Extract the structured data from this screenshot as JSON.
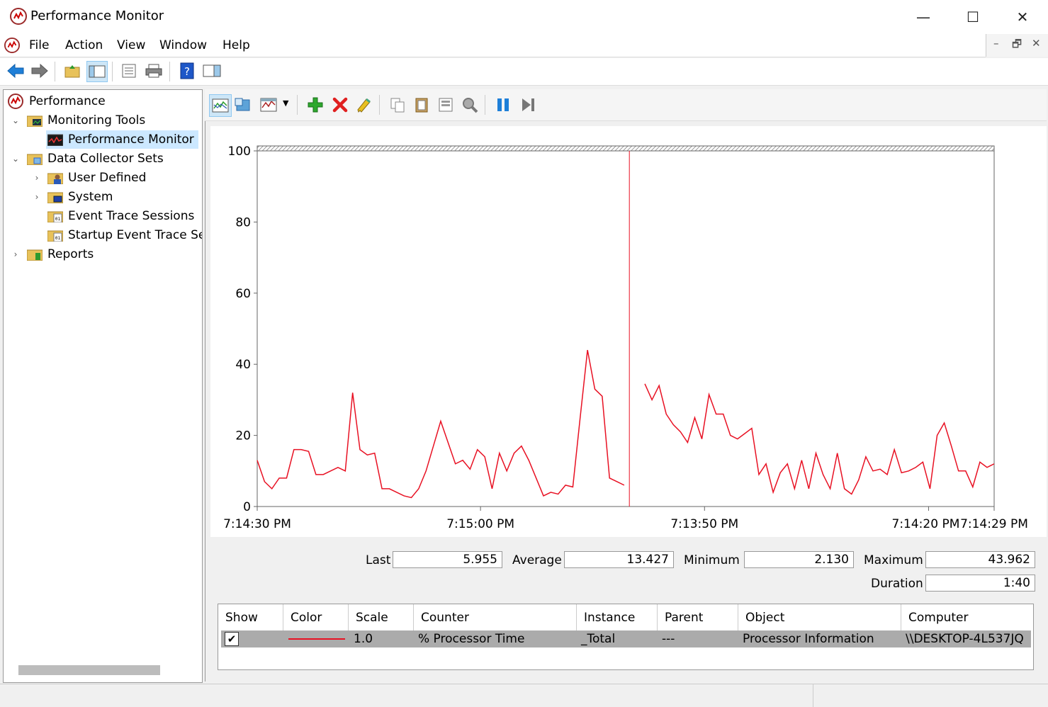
{
  "window": {
    "title": "Performance Monitor",
    "minimize": "—",
    "maximize": "☐",
    "close": "✕"
  },
  "menu": {
    "items": [
      "File",
      "Action",
      "View",
      "Window",
      "Help"
    ]
  },
  "mdi": {
    "minimize": "–",
    "restore": "🗗",
    "close": "✕"
  },
  "tree": {
    "root": "Performance",
    "monitoring_tools": "Monitoring Tools",
    "performance_monitor": "Performance Monitor",
    "data_collector_sets": "Data Collector Sets",
    "user_defined": "User Defined",
    "system": "System",
    "event_trace_sessions": "Event Trace Sessions",
    "startup_event_trace": "Startup Event Trace Sess",
    "reports": "Reports"
  },
  "chart_data": {
    "type": "line",
    "ylim": [
      0,
      100
    ],
    "yticks": [
      0,
      20,
      40,
      60,
      80,
      100
    ],
    "xticks": [
      "7:14:30 PM",
      "7:15:00 PM",
      "7:13:50 PM",
      "7:14:20 PM",
      "7:14:29 PM"
    ],
    "series": [
      {
        "color": "#e81123",
        "values": [
          13,
          7,
          5,
          8,
          8,
          16,
          16,
          15.5,
          9,
          9,
          10,
          11,
          10,
          32,
          16,
          14.5,
          15,
          5,
          5,
          4,
          3,
          2.5,
          5,
          10,
          17,
          24,
          18,
          12,
          13,
          10.5,
          16,
          14,
          5,
          15,
          10,
          15,
          17,
          13,
          8,
          3,
          4,
          3.5,
          6,
          5.5,
          25,
          44,
          33,
          31,
          8,
          7,
          6
        ]
      },
      {
        "color": "#e81123",
        "values": [
          34.5,
          30,
          34,
          26,
          23,
          21,
          18,
          25,
          19,
          31.5,
          26,
          26,
          20,
          19,
          20.5,
          22,
          9,
          12,
          4,
          9.5,
          12,
          5,
          13,
          5,
          15,
          9,
          5,
          15,
          5,
          3.5,
          7.5,
          14,
          10,
          10.5,
          9,
          16,
          9.5,
          10,
          11,
          12.5,
          5,
          20,
          23.5,
          17,
          10,
          10,
          5.5,
          12.5,
          11,
          12
        ]
      }
    ],
    "cursor_fraction": 0.505
  },
  "stats": {
    "last_label": "Last",
    "last": "5.955",
    "avg_label": "Average",
    "avg": "13.427",
    "min_label": "Minimum",
    "min": "2.130",
    "max_label": "Maximum",
    "max": "43.962",
    "dur_label": "Duration",
    "dur": "1:40"
  },
  "legend": {
    "headers": [
      "Show",
      "Color",
      "Scale",
      "Counter",
      "Instance",
      "Parent",
      "Object",
      "Computer"
    ],
    "row": {
      "show": "✔",
      "color": "#e81123",
      "scale": "1.0",
      "counter": "% Processor Time",
      "instance": "_Total",
      "parent": "---",
      "object": "Processor Information",
      "computer": "\\\\DESKTOP-4L537JQ"
    }
  }
}
